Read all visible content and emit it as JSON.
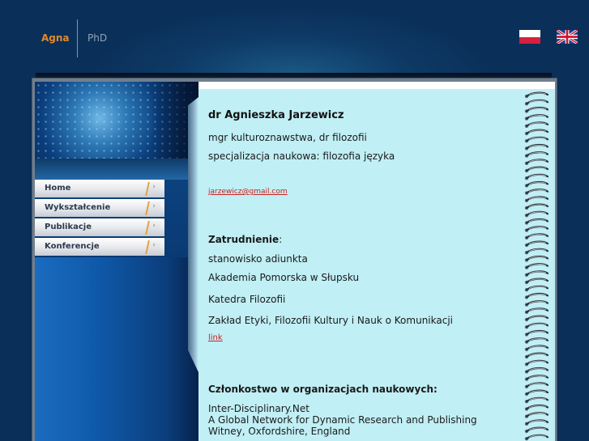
{
  "header": {
    "brand_name": "Agna",
    "brand_suffix": "PhD",
    "languages": [
      {
        "code": "pl",
        "icon": "polish-flag-icon"
      },
      {
        "code": "en",
        "icon": "uk-flag-icon"
      }
    ]
  },
  "menu": {
    "items": [
      {
        "label": "Home"
      },
      {
        "label": "Wykształcenie"
      },
      {
        "label": "Publikacje"
      },
      {
        "label": "Konferencje"
      }
    ],
    "arrow": "›"
  },
  "content": {
    "name": "dr Agnieszka Jarzewicz",
    "degree": "mgr kulturoznawstwa, dr filozofii",
    "specialization": "specjalizacja naukowa: filozofia języka",
    "email": "jarzewicz@gmail.com",
    "employment_heading": "Zatrudnienie",
    "employment_colon": ":",
    "position": "stanowisko adiunkta",
    "institution": "Akademia Pomorska w Słupsku",
    "department": "Katedra Filozofii",
    "unit": "Zakład Etyki, Filozofii Kultury i Nauk o Komunikacji",
    "link_label": "link",
    "membership_heading": "Członkostwo w organizacjach naukowych:",
    "org_name": "Inter-Disciplinary.Net",
    "org_desc": "A Global Network for Dynamic Research and Publishing",
    "org_location": "Witney, Oxfordshire, England"
  },
  "colors": {
    "background": "#0b3260",
    "brand": "#e08a2c",
    "content_bg": "#c0eff5",
    "link": "#cc1f1f"
  }
}
